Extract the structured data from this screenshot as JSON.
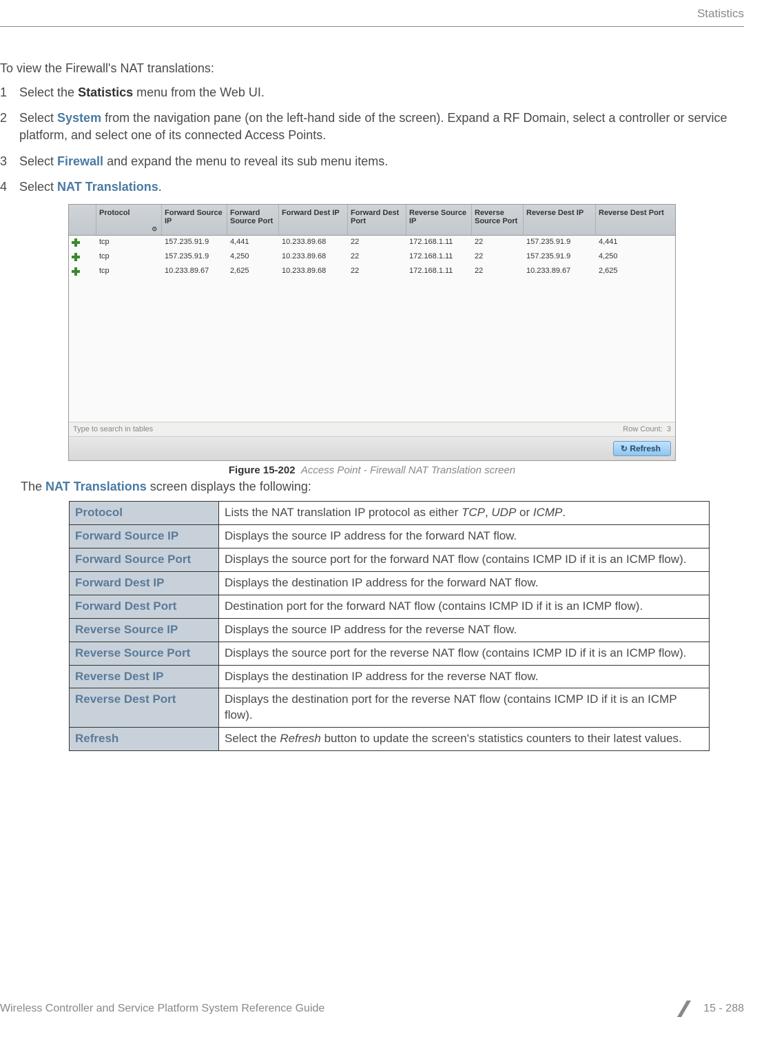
{
  "header": {
    "section": "Statistics"
  },
  "intro": "To view the Firewall's NAT translations:",
  "steps": [
    {
      "num": "1",
      "pre": "Select the ",
      "bold": "Statistics",
      "boldClass": "bold-term",
      "post": " menu from the Web UI."
    },
    {
      "num": "2",
      "pre": "Select ",
      "bold": "System",
      "boldClass": "bold-link",
      "post": " from the navigation pane (on the left-hand side of the screen). Expand a RF Domain, select a controller or service platform, and select one of its connected Access Points."
    },
    {
      "num": "3",
      "pre": "Select ",
      "bold": "Firewall",
      "boldClass": "bold-link",
      "post": " and expand the menu to reveal its sub menu items."
    },
    {
      "num": "4",
      "pre": "Select ",
      "bold": "NAT Translations",
      "boldClass": "bold-link",
      "post": "."
    }
  ],
  "screenshot": {
    "headers": [
      "",
      "Protocol",
      "Forward Source IP",
      "Forward Source Port",
      "Forward Dest IP",
      "Forward Dest Port",
      "Reverse Source IP",
      "Reverse Source Port",
      "Reverse Dest IP",
      "Reverse Dest Port"
    ],
    "rows": [
      [
        "tcp",
        "157.235.91.9",
        "4,441",
        "10.233.89.68",
        "22",
        "172.168.1.11",
        "22",
        "157.235.91.9",
        "4,441"
      ],
      [
        "tcp",
        "157.235.91.9",
        "4,250",
        "10.233.89.68",
        "22",
        "172.168.1.11",
        "22",
        "157.235.91.9",
        "4,250"
      ],
      [
        "tcp",
        "10.233.89.67",
        "2,625",
        "10.233.89.68",
        "22",
        "172.168.1.11",
        "22",
        "10.233.89.67",
        "2,625"
      ]
    ],
    "searchPlaceholder": "Type to search in tables",
    "rowCountLabel": "Row Count:",
    "rowCountValue": "3",
    "refreshLabel": "Refresh"
  },
  "figure": {
    "label": "Figure 15-202",
    "title": "Access Point - Firewall NAT Translation screen"
  },
  "postText": {
    "pre": "The ",
    "bold": "NAT Translations",
    "post": " screen displays the following:"
  },
  "descTable": [
    {
      "label": "Protocol",
      "desc": "Lists the NAT translation IP protocol as either <em>TCP</em>, <em>UDP</em> or <em>ICMP</em>."
    },
    {
      "label": "Forward Source IP",
      "desc": "Displays the source IP address for the forward NAT flow."
    },
    {
      "label": "Forward Source Port",
      "desc": "Displays the source port for the forward NAT flow (contains ICMP ID if it is an ICMP flow)."
    },
    {
      "label": "Forward Dest IP",
      "desc": "Displays the destination IP address for the forward NAT flow."
    },
    {
      "label": "Forward Dest Port",
      "desc": "Destination port for the forward NAT flow (contains ICMP ID if it is an ICMP flow)."
    },
    {
      "label": "Reverse Source IP",
      "desc": "Displays the source IP address for the reverse NAT flow."
    },
    {
      "label": "Reverse Source Port",
      "desc": "Displays the source port for the reverse NAT flow (contains ICMP ID if it is an ICMP flow)."
    },
    {
      "label": "Reverse Dest IP",
      "desc": "Displays the destination IP address for the reverse NAT flow."
    },
    {
      "label": "Reverse Dest Port",
      "desc": "Displays the destination port for the reverse NAT flow (contains ICMP ID if it is an ICMP flow)."
    },
    {
      "label": "Refresh",
      "desc": "Select the <em>Refresh</em> button to update the screen's statistics counters to their latest values."
    }
  ],
  "footer": {
    "left": "Wireless Controller and Service Platform System Reference Guide",
    "right": "15 - 288"
  }
}
